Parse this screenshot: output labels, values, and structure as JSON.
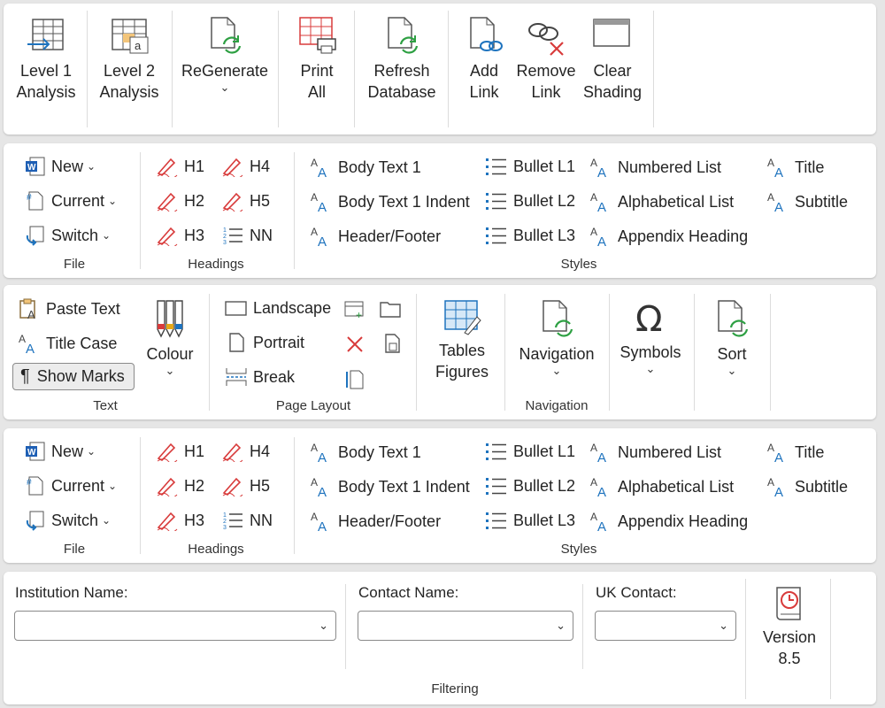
{
  "ribbon1": {
    "buttons": [
      {
        "label": "Level 1\nAnalysis",
        "icon": "level1-analysis-icon"
      },
      {
        "label": "Level 2\nAnalysis",
        "icon": "level2-analysis-icon"
      },
      {
        "label": "ReGenerate",
        "icon": "regenerate-icon",
        "dropdown": true
      },
      {
        "label": "Print\nAll",
        "icon": "print-all-icon"
      },
      {
        "label": "Refresh\nDatabase",
        "icon": "refresh-database-icon"
      },
      {
        "label": "Add\nLink",
        "icon": "add-link-icon"
      },
      {
        "label": "Remove\nLink",
        "icon": "remove-link-icon"
      },
      {
        "label": "Clear\nShading",
        "icon": "clear-shading-icon"
      }
    ]
  },
  "ribbon2": {
    "file": {
      "new": "New",
      "current": "Current",
      "switch": "Switch",
      "label": "File"
    },
    "headings": {
      "h1": "H1",
      "h2": "H2",
      "h3": "H3",
      "h4": "H4",
      "h5": "H5",
      "nn": "NN",
      "label": "Headings"
    },
    "styles": {
      "body1": "Body Text 1",
      "body1_indent": "Body Text 1 Indent",
      "header_footer": "Header/Footer",
      "bullet1": "Bullet L1",
      "bullet2": "Bullet L2",
      "bullet3": "Bullet L3",
      "numbered": "Numbered List",
      "alphabetical": "Alphabetical List",
      "appendix": "Appendix Heading",
      "title": "Title",
      "subtitle": "Subtitle",
      "label": "Styles"
    }
  },
  "ribbon3": {
    "text": {
      "paste": "Paste Text",
      "title_case": "Title Case",
      "show_marks": "Show Marks",
      "colour": "Colour",
      "label": "Text"
    },
    "page_layout": {
      "landscape": "Landscape",
      "portrait": "Portrait",
      "break": "Break",
      "label": "Page Layout"
    },
    "tables_figures": "Tables\nFigures",
    "navigation": {
      "button": "Navigation",
      "label": "Navigation"
    },
    "symbols": "Symbols",
    "sort": "Sort"
  },
  "ribbon4": {
    "file": {
      "new": "New",
      "current": "Current",
      "switch": "Switch",
      "label": "File"
    },
    "headings": {
      "h1": "H1",
      "h2": "H2",
      "h3": "H3",
      "h4": "H4",
      "h5": "H5",
      "nn": "NN",
      "label": "Headings"
    },
    "styles": {
      "body1": "Body Text 1",
      "body1_indent": "Body Text 1 Indent",
      "header_footer": "Header/Footer",
      "bullet1": "Bullet L1",
      "bullet2": "Bullet L2",
      "bullet3": "Bullet L3",
      "numbered": "Numbered List",
      "alphabetical": "Alphabetical List",
      "appendix": "Appendix Heading",
      "title": "Title",
      "subtitle": "Subtitle",
      "label": "Styles"
    }
  },
  "ribbon5": {
    "institution_label": "Institution Name:",
    "contact_label": "Contact Name:",
    "uk_contact_label": "UK Contact:",
    "institution_value": "",
    "contact_value": "",
    "uk_contact_value": "",
    "filtering_label": "Filtering",
    "version": "Version\n8.5"
  },
  "colors": {
    "accent_blue": "#1e73be",
    "heading_red": "#d83b3b",
    "refresh_green": "#2ea043"
  }
}
